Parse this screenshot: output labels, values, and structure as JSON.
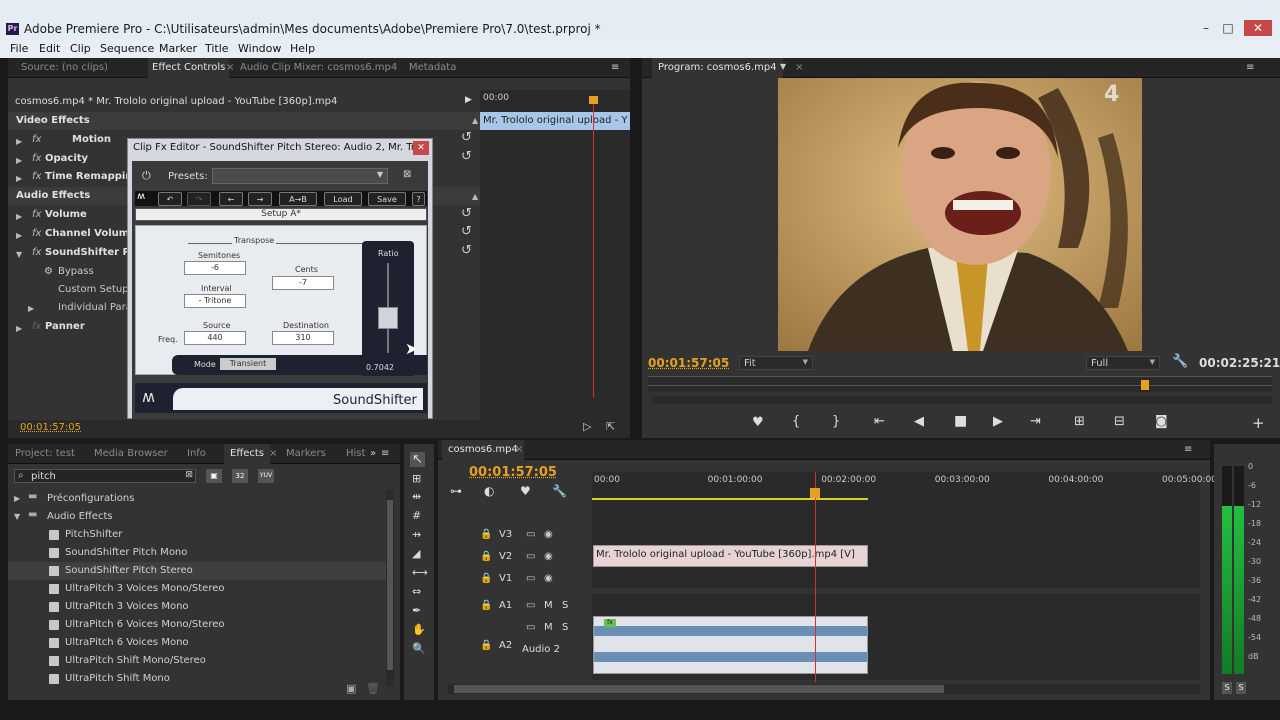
{
  "window": {
    "title": "Adobe Premiere Pro - C:\\Utilisateurs\\admin\\Mes documents\\Adobe\\Premiere Pro\\7.0\\test.prproj *",
    "app_icon": "Pr"
  },
  "menu": [
    "File",
    "Edit",
    "Clip",
    "Sequence",
    "Marker",
    "Title",
    "Window",
    "Help"
  ],
  "source_tabs": [
    "Source: (no clips)",
    "Effect Controls",
    "Audio Clip Mixer: cosmos6.mp4",
    "Metadata"
  ],
  "effect_controls": {
    "clip_path": "cosmos6.mp4 * Mr. Trololo original upload - YouTube [360p].mp4",
    "timeline_start": "00:00",
    "mini_clip": "Mr. Trololo original upload - Y",
    "video_header": "Video Effects",
    "video_effects": [
      "Motion",
      "Opacity",
      "Time Remapping"
    ],
    "audio_header": "Audio Effects",
    "audio_effects": [
      "Volume",
      "Channel Volume",
      "SoundShifter Pit"
    ],
    "params": [
      "Bypass",
      "Custom Setup",
      "Individual Para"
    ],
    "panner": "Panner",
    "timecode": "00:01:57:05",
    "fx": "fx"
  },
  "fx_editor": {
    "title": "Clip Fx Editor - SoundShifter Pitch Stereo: Audio 2, Mr. Tr...",
    "presets_label": "Presets:",
    "buttons": [
      "A→B",
      "Load",
      "Save",
      "?"
    ],
    "setup": "Setup A*",
    "transpose": "Transpose",
    "semitones_label": "Semitones",
    "semitones": "-6",
    "cents_label": "Cents",
    "cents": "-7",
    "interval_label": "Interval",
    "interval": "- Tritone",
    "source_label": "Source",
    "source": "440",
    "dest_label": "Destination",
    "dest": "310",
    "freq_label": "Freq.",
    "ratio_label": "Ratio",
    "ratio": "0.7042",
    "ratio_level": 0.55,
    "mode_label": "Mode",
    "mode": "Transient",
    "brand": "SoundShifter"
  },
  "program": {
    "tab": "Program: cosmos6.mp4",
    "tc_current": "00:01:57:05",
    "tc_total": "00:02:25:21",
    "fit": "Fit",
    "quality": "Full",
    "playhead": 0.8,
    "overlay_logo": "4"
  },
  "project_tabs": [
    "Project: test",
    "Media Browser",
    "Info",
    "Effects",
    "Markers",
    "Hist"
  ],
  "effects_search": "pitch",
  "tree": {
    "presets": "Préconfigurations",
    "audio_effects": "Audio Effects",
    "items": [
      "PitchShifter",
      "SoundShifter Pitch Mono",
      "SoundShifter Pitch Stereo",
      "UltraPitch 3 Voices Mono/Stereo",
      "UltraPitch 3 Voices Mono",
      "UltraPitch 6 Voices Mono/Stereo",
      "UltraPitch 6 Voices Mono",
      "UltraPitch Shift Mono/Stereo",
      "UltraPitch Shift Mono"
    ],
    "selected_index": 2
  },
  "timeline": {
    "tab": "cosmos6.mp4",
    "timecode": "00:01:57:05",
    "ruler": [
      "00:00",
      "00:01:00:00",
      "00:02:00:00",
      "00:03:00:00",
      "00:04:00:00",
      "00:05:00:00"
    ],
    "video_tracks": [
      "V3",
      "V2",
      "V1"
    ],
    "audio_tracks": [
      "A1",
      "A2"
    ],
    "audio2_name": "Audio 2",
    "video_clip": "Mr. Trololo original upload - YouTube [360p].mp4 [V]",
    "m": "M",
    "s": "S"
  },
  "meter": {
    "labels": [
      "0",
      "-6",
      "-12",
      "-18",
      "-24",
      "-30",
      "-36",
      "-42",
      "-48",
      "-54",
      "dB"
    ],
    "solo": [
      "S",
      "S"
    ]
  },
  "colors": {
    "accent": "#e8a020",
    "blue": "#4a9fe8",
    "playhead": "#d43030"
  }
}
